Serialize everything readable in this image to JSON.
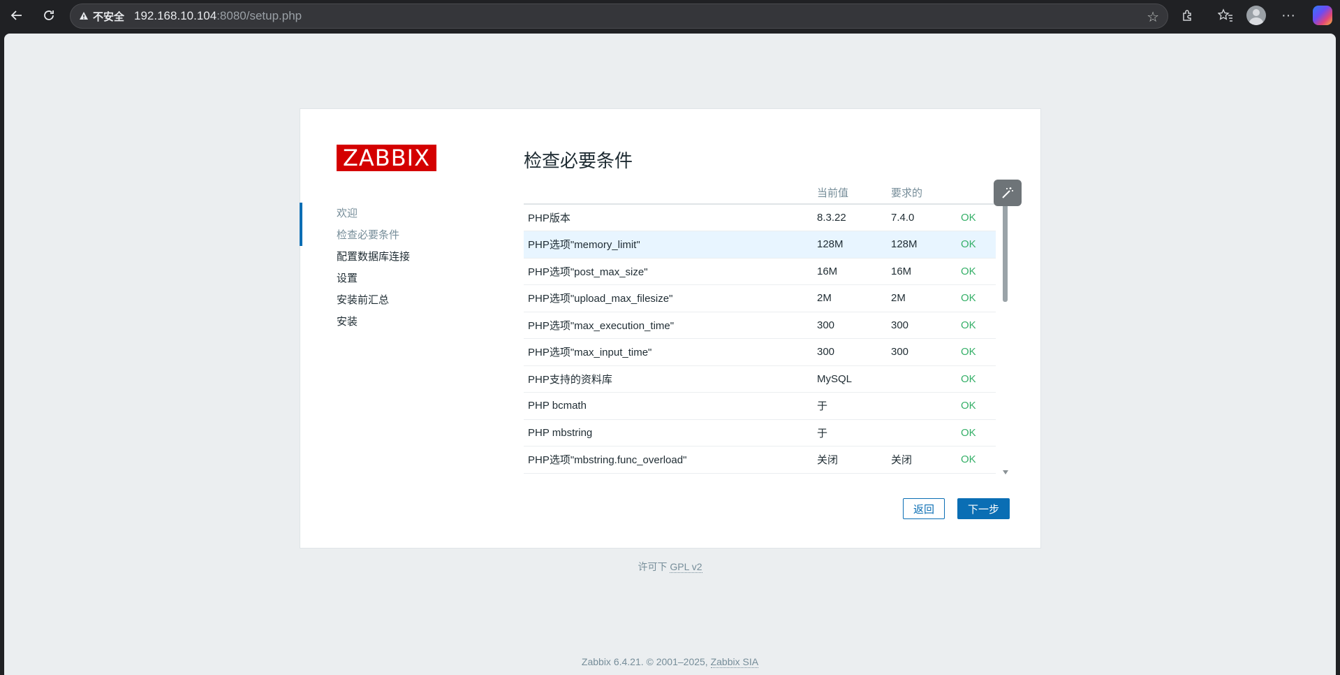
{
  "browser": {
    "security_label": "不安全",
    "url_host": "192.168.10.104",
    "url_rest": ":8080/setup.php"
  },
  "setup": {
    "logo_text": "ZABBIX",
    "steps": [
      {
        "label": "欢迎",
        "state": "done"
      },
      {
        "label": "检查必要条件",
        "state": "active"
      },
      {
        "label": "配置数据库连接",
        "state": "pending"
      },
      {
        "label": "设置",
        "state": "pending"
      },
      {
        "label": "安装前汇总",
        "state": "pending"
      },
      {
        "label": "安装",
        "state": "pending"
      }
    ],
    "title": "检查必要条件",
    "table": {
      "headers": [
        "",
        "当前值",
        "要求的",
        ""
      ],
      "rows": [
        {
          "name": "PHP版本",
          "current": "8.3.22",
          "required": "7.4.0",
          "status": "OK"
        },
        {
          "name": "PHP选项\"memory_limit\"",
          "current": "128M",
          "required": "128M",
          "status": "OK"
        },
        {
          "name": "PHP选项\"post_max_size\"",
          "current": "16M",
          "required": "16M",
          "status": "OK"
        },
        {
          "name": "PHP选项\"upload_max_filesize\"",
          "current": "2M",
          "required": "2M",
          "status": "OK"
        },
        {
          "name": "PHP选项\"max_execution_time\"",
          "current": "300",
          "required": "300",
          "status": "OK"
        },
        {
          "name": "PHP选项\"max_input_time\"",
          "current": "300",
          "required": "300",
          "status": "OK"
        },
        {
          "name": "PHP支持的资料库",
          "current": "MySQL",
          "required": "",
          "status": "OK"
        },
        {
          "name": "PHP bcmath",
          "current": "于",
          "required": "",
          "status": "OK"
        },
        {
          "name": "PHP mbstring",
          "current": "于",
          "required": "",
          "status": "OK"
        },
        {
          "name": "PHP选项\"mbstring.func_overload\"",
          "current": "关闭",
          "required": "关闭",
          "status": "OK"
        }
      ]
    },
    "back_label": "返回",
    "next_label": "下一步"
  },
  "license": {
    "prefix": "许可下 ",
    "link": "GPL v2"
  },
  "footer": {
    "prefix": "Zabbix 6.4.21. © 2001–2025, ",
    "link": "Zabbix SIA"
  },
  "colors": {
    "accent": "#0a6eb4",
    "logo_bg": "#d40000",
    "ok": "#34af67",
    "page_bg": "#ebeef0"
  }
}
